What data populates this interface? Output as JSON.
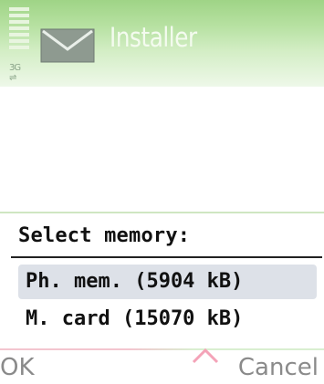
{
  "app": {
    "title": "Installer",
    "header_icon": "envelope-icon",
    "network_label": "3G"
  },
  "dialog": {
    "heading": "Select memory:",
    "options": [
      {
        "label": "Ph. mem. (5904 kB)",
        "selected": true
      },
      {
        "label": "M. card (15070 kB)",
        "selected": false
      }
    ]
  },
  "softkeys": {
    "left": "OK",
    "right": "Cancel",
    "center_icon": "caret-up-icon"
  },
  "colors": {
    "header_green": "#9fd486",
    "selection_bg": "#dde1e8",
    "softkey_caret": "#f4a3b8"
  }
}
